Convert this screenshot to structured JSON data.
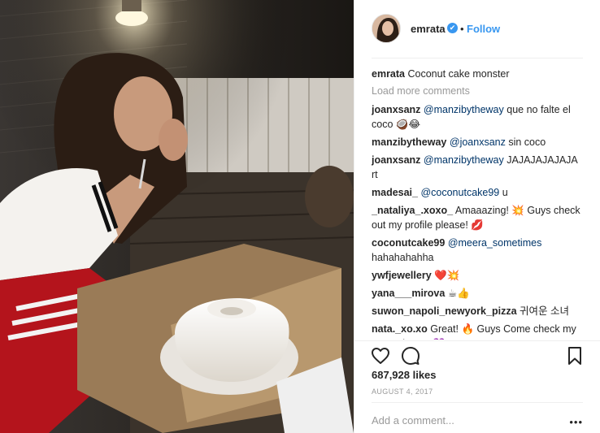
{
  "post": {
    "username": "emrata",
    "follow_label": "Follow",
    "separator": "•",
    "verified_mark": "✔",
    "caption_user": "emrata",
    "caption_text": "Coconut cake monster"
  },
  "comments": {
    "load_more_label": "Load more comments",
    "items": [
      {
        "user": "joanxsanz",
        "mention": "@manzibytheway",
        "text": " que no falte el coco 🥥😂"
      },
      {
        "user": "manzibytheway",
        "mention": "@joanxsanz",
        "text": " sin coco"
      },
      {
        "user": "joanxsanz",
        "mention": "@manzibytheway",
        "text": " JAJAJAJAJAJA rt"
      },
      {
        "user": "madesai_",
        "mention": "@coconutcake99",
        "text": " u"
      },
      {
        "user": "_nataliya_.xoxo_",
        "mention": "",
        "text": "Amaaazing! 💥 Guys check out my profile please! 💋"
      },
      {
        "user": "coconutcake99",
        "mention": "@meera_sometimes",
        "text": " hahahahahha"
      },
      {
        "user": "ywfjewellery",
        "mention": "",
        "text": "❤️💥"
      },
      {
        "user": "yana___mirova",
        "mention": "",
        "text": "☕👍"
      },
      {
        "user": "suwon_napoli_newyork_pizza",
        "mention": "",
        "text": "귀여운 소녀"
      },
      {
        "user": "nata._xo.xo",
        "mention": "",
        "text": "Great! 🔥 Guys Come check my page please! 💜"
      }
    ]
  },
  "stats": {
    "likes": "687,928 likes",
    "date": "August 4, 2017"
  },
  "composer": {
    "placeholder": "Add a comment...",
    "more_label": "•••"
  },
  "icons": {
    "like": "heart-icon",
    "comment": "comment-icon",
    "save": "bookmark-icon",
    "verified": "verified-badge-icon",
    "options": "more-options-icon"
  },
  "colors": {
    "link_blue": "#3897f0",
    "mention_blue": "#003569",
    "muted": "#999999",
    "text": "#262626"
  }
}
